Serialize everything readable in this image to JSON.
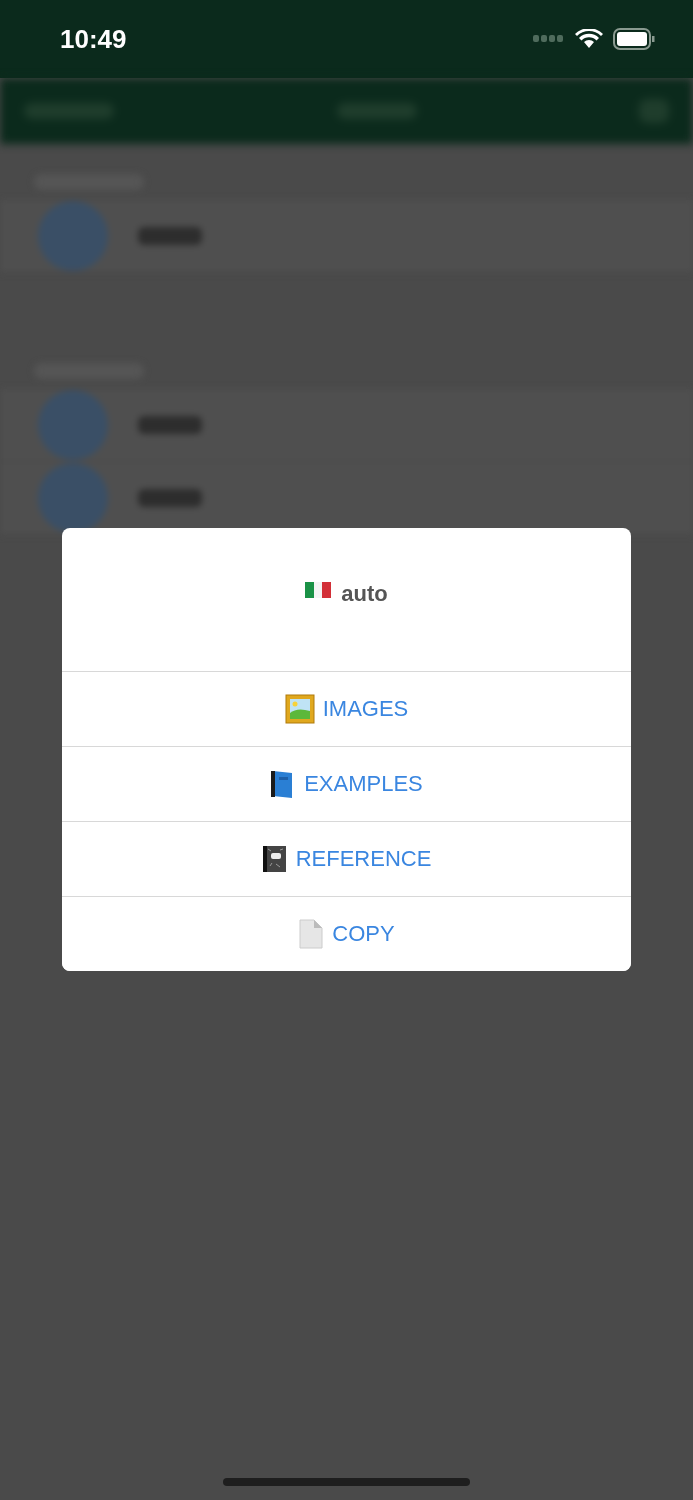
{
  "status_bar": {
    "time": "10:49"
  },
  "dialog": {
    "title": "auto",
    "actions": [
      {
        "kind": "picture",
        "label": "IMAGES"
      },
      {
        "kind": "book",
        "label": "EXAMPLES"
      },
      {
        "kind": "notebook",
        "label": "REFERENCE"
      },
      {
        "kind": "page",
        "label": "COPY"
      }
    ]
  }
}
